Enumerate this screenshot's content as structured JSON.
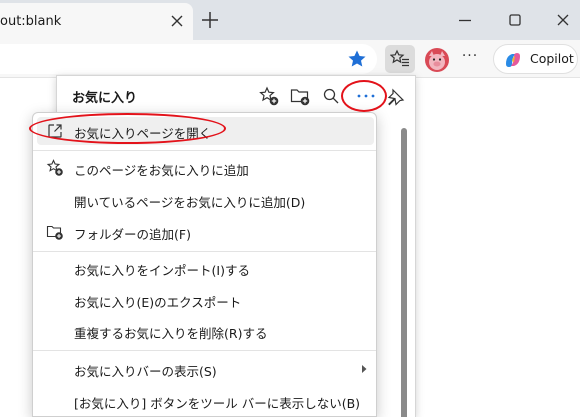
{
  "tab": {
    "title": "out:blank"
  },
  "toolbar": {
    "copilot_label": "Copilot",
    "more_label": "···"
  },
  "favorites": {
    "title": "お気に入り",
    "icons": [
      "add-favorite-icon",
      "add-folder-icon",
      "search-icon",
      "more-options-icon",
      "pin-icon"
    ]
  },
  "menu": {
    "items": [
      {
        "label": "お気に入りページを開く",
        "icon": "open-external-icon"
      },
      {
        "label": "このページをお気に入りに追加",
        "icon": "add-favorite-icon"
      },
      {
        "label": "開いているページをお気に入りに追加(D)"
      },
      {
        "label": "フォルダーの追加(F)",
        "icon": "add-folder-icon"
      },
      {
        "label": "お気に入りをインポート(I)する"
      },
      {
        "label": "お気に入り(E)のエクスポート"
      },
      {
        "label": "重複するお気に入りを削除(R)する"
      },
      {
        "label": "お気に入りバーの表示(S)",
        "submenu": true
      },
      {
        "label": "[お気に入り] ボタンをツール バーに表示しない(B)"
      }
    ]
  },
  "colors": {
    "annotation_red": "#e3121a",
    "star_blue": "#1f6fd6",
    "tabstrip": "#dfe3e8"
  }
}
